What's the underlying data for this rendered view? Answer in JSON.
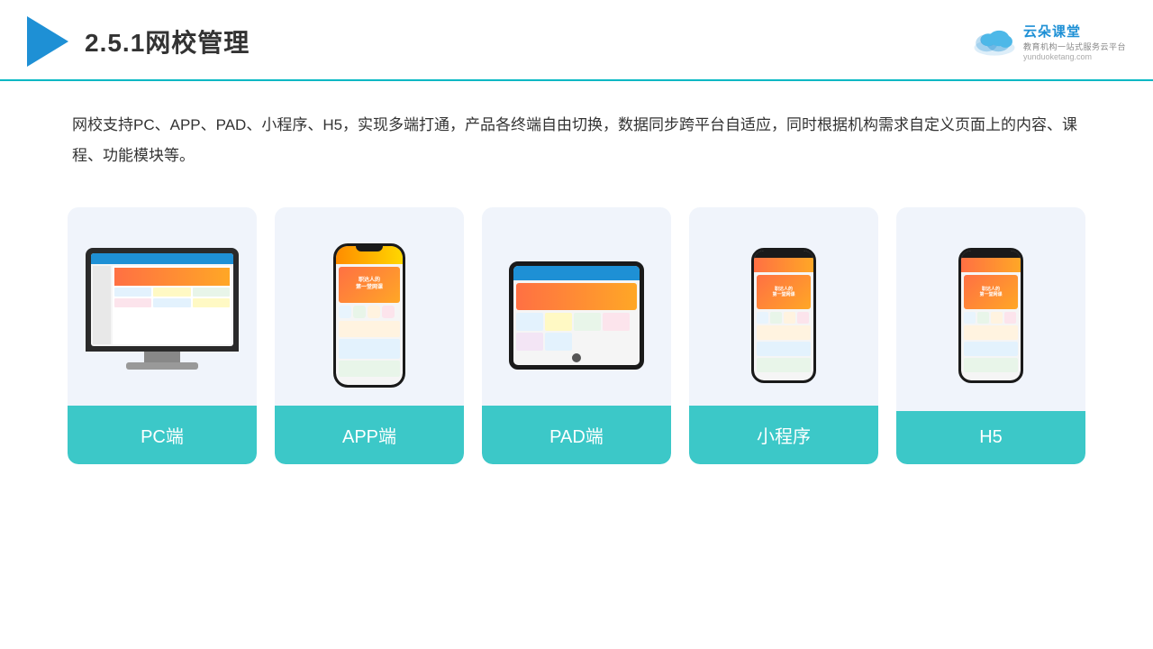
{
  "header": {
    "title": "2.5.1网校管理",
    "logo_main": "云朵课堂",
    "logo_sub": "教育机构一站式服务云平台",
    "logo_domain": "yunduoketang.com"
  },
  "description": {
    "text": "网校支持PC、APP、PAD、小程序、H5，实现多端打通，产品各终端自由切换，数据同步跨平台自适应，同时根据机构需求自定义页面上的内容、课程、功能模块等。"
  },
  "cards": [
    {
      "id": "pc",
      "label": "PC端"
    },
    {
      "id": "app",
      "label": "APP端"
    },
    {
      "id": "pad",
      "label": "PAD端"
    },
    {
      "id": "miniprogram",
      "label": "小程序"
    },
    {
      "id": "h5",
      "label": "H5"
    }
  ],
  "colors": {
    "teal": "#3cc8c8",
    "blue": "#1e90d5",
    "card_bg": "#f0f4fb"
  }
}
